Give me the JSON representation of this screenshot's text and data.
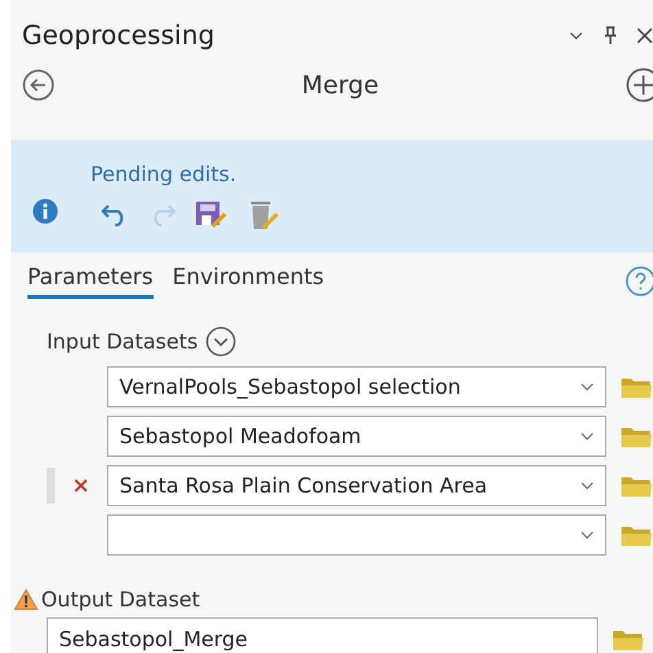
{
  "pane": {
    "title": "Geoprocessing"
  },
  "tool": {
    "title": "Merge"
  },
  "banner": {
    "message": "Pending edits.",
    "redo_disabled": true
  },
  "tabs": [
    {
      "label": "Parameters",
      "selected": true
    },
    {
      "label": "Environments",
      "selected": false
    }
  ],
  "input_datasets": {
    "label": "Input Datasets",
    "rows": [
      {
        "value": "VernalPools_Sebastopol selection",
        "active": false
      },
      {
        "value": "Sebastopol Meadofoam",
        "active": false
      },
      {
        "value": "Santa Rosa Plain Conservation Area",
        "active": true
      },
      {
        "value": "",
        "active": false
      }
    ]
  },
  "output_dataset": {
    "label": "Output Dataset",
    "warning": true,
    "value": "Sebastopol_Merge"
  }
}
